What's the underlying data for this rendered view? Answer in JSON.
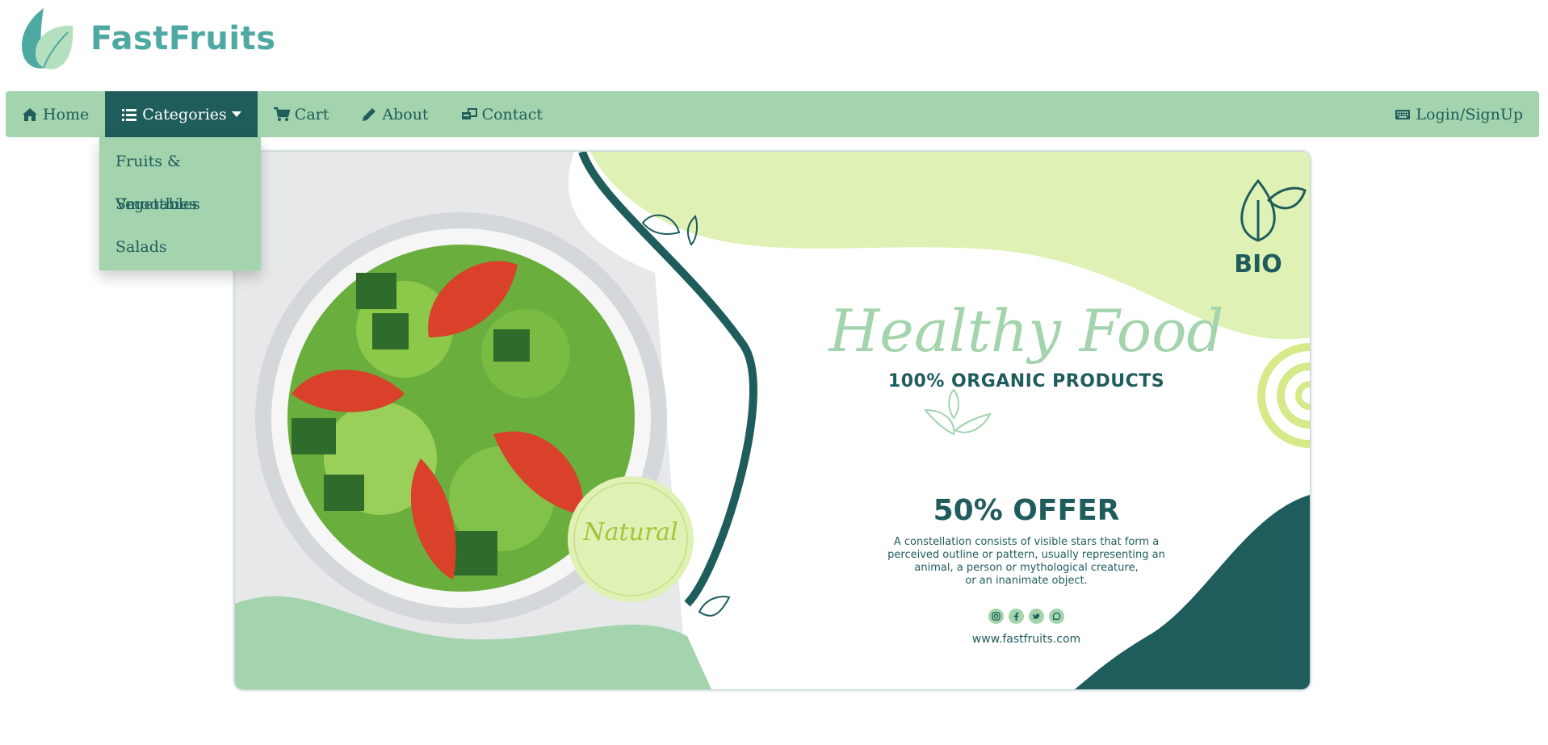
{
  "brand": {
    "name": "FastFruits",
    "logo_icon": "leaf-logo-icon"
  },
  "colors": {
    "navbar": "#a3d4ad",
    "active": "#1f5c5c",
    "text": "#1f5c5c",
    "brand": "#4fa9a3",
    "lime": "#e0f1b5"
  },
  "nav": {
    "home": "Home",
    "categories": "Categories",
    "cart": "Cart",
    "about": "About",
    "contact": "Contact",
    "login": "Login/SignUp"
  },
  "dropdown": {
    "items": [
      "Fruits & Vegetables",
      "Smoothies",
      "Salads"
    ]
  },
  "banner": {
    "headline": "Healthy Food",
    "subhead": "100% ORGANIC PRODUCTS",
    "offer": "50% OFFER",
    "desc_lines": [
      "A constellation consists of visible stars that form a",
      "perceived outline or pattern, usually representing an",
      "animal, a person or mythological creature,",
      "or an inanimate object."
    ],
    "website": "www.fastfruits.com",
    "bio": "BIO",
    "natural": "Natural",
    "social_icons": [
      "instagram-icon",
      "facebook-icon",
      "twitter-icon",
      "whatsapp-icon"
    ]
  }
}
